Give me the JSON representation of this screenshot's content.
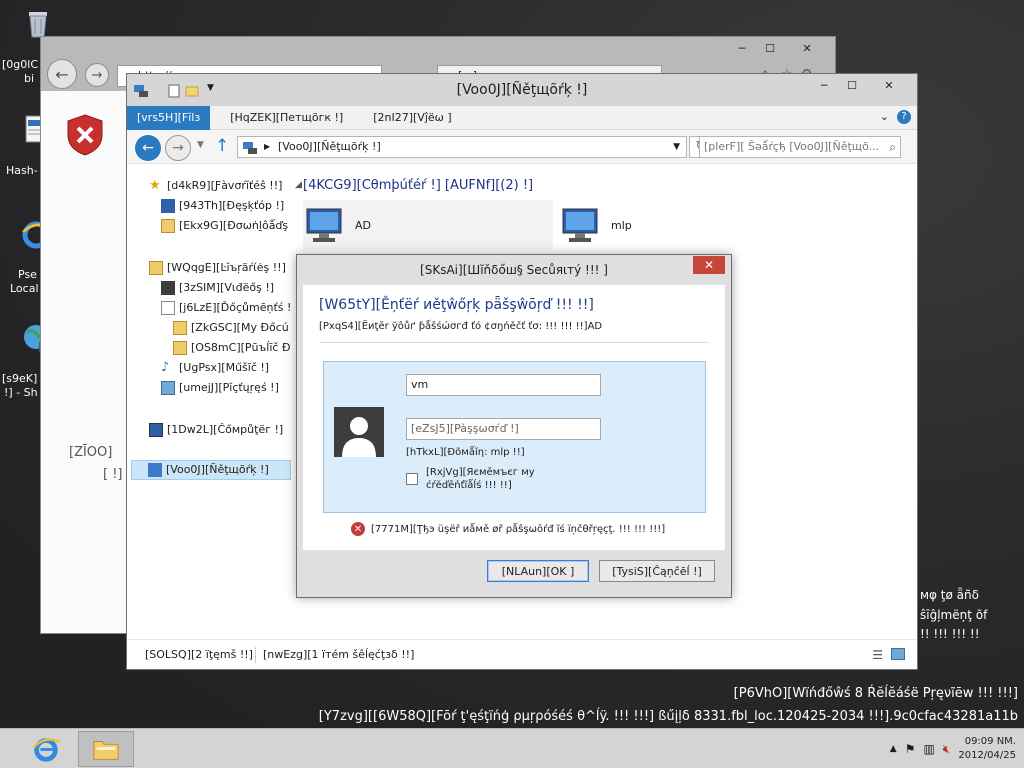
{
  "desktop": {
    "recycle_label_line1": "[0g0lC",
    "recycle_label_line2": "bi",
    "hash_label": "Hash-",
    "ie_label_line1": "Pse",
    "ie_label_line2": "Local",
    "net_label_line1": "[s9eK]",
    "net_label_line2": "!] - Sh",
    "left_text_1": "[ZĪOO]",
    "left_text_2": "[ !]",
    "right_text_1": "мφ ţø ǟñδ",
    "right_text_2": "ŝīĝļmëņţ õf",
    "right_text_3": "!! !!! !!! !!"
  },
  "ie_window": {
    "tab1": "http://... ",
    "tab2": "[...]",
    "min": "─",
    "max": "☐",
    "close": "✕"
  },
  "explorer": {
    "title": "[Voo0J][Ñěţщõŕķ !]",
    "min": "─",
    "max": "☐",
    "close": "✕",
    "tabs": [
      "[vrs5H][Fĭlз",
      "[HqZEK][Петщõгк !]",
      "[2nI27][Vĵëω ]"
    ],
    "address": "[Voo0J][Ñěţщõŕķ !]",
    "search_placeholder": "[plerF][ Ŝəǻŕçђ [Voo0J][Ñěţщõ...",
    "nav": {
      "favorites": "[d4kR9][Ƒàvσŕĭťéŝ !!]",
      "desktop": "[943Th][Ðęşķťóp !]",
      "downloads": "[Ekx9G][Ðσωṅḻôǻďş",
      "libraries": "[WQqgE][Ŀĭъŗäŕίėş !!]",
      "videos": "[3zSIM][Vιđëőş !]",
      "documents": "[j6LzE][Ďőçůmēņťś !",
      "my_documents": "[ZkGSC][My Đőcú",
      "public_docs": "[OS8mC][Pūъĺīč Ð",
      "music": "[UgPsx][Мűšĩč !]",
      "pictures": "[umejJ][Pĭçťųŗęś !]",
      "computer": "[1Dw2L][Ĉőмрůţёг !]",
      "network": "[Voo0J][Ñěţщõŕķ !]"
    },
    "section_header": "[4KCG9][Cθmþúťéŕ !] [AUFNf][(2) !]",
    "computers": [
      "AD",
      "mlp"
    ],
    "status_items": "[SOLSQ][2 ïţęmš !!]",
    "status_selected": "[nwEzg][1 ïтém šêĺęćţзδ !!]"
  },
  "dialog": {
    "title": "[SKsAi][Шĭňδőш§ Ѕеcůяιтý !!! ]",
    "close": "✕",
    "heading": "[W65tY][Ěņťëŕ иěţŵőŗķ pǟšşŵōŗď !!! !!]",
    "subheading": "[PxqS4][Ёиţěr ўôůґ ƥǻšśώσгđ ťό ¢σŋńěčť ťσ:  !!! !!! !!]AD",
    "username": "vm",
    "password_placeholder": "[eZsJ5][Pàşşωσŕď !]",
    "domain": "[hTkxL][Ðõмǻĭη: mlp !!]",
    "remember": "[RxjVg][Яємěмъєг му ćŕĕďēńťĩǻĺś !!! !!]",
    "error": "[7771M][Ţђэ üşёř иǻмě øř ρǻŝşωōŕđ ĩś їņčθřŗęçţ. !!! !!! !!!]",
    "ok": "[NLAun][OK ]",
    "cancel": "[TysiS][Ĉąņĉēĺ !]"
  },
  "watermark": {
    "line1": "[P6VhO][Wïńđőŵś 8 Ŕĕĺĕáśë Pŗęνĩēw !!! !!!]",
    "line2": "[Y7zvg][[6W58Q][Fōŕ ţ'ęśţïńģ ρµŗρóśéś θ^ĺÿ. !!! !!!] ßűįļδ 8331.fbl_loc.120425-2034 !!!].9c0cfac43281a11b"
  },
  "taskbar": {
    "time": "09:09 NM.",
    "date": "2012/04/25"
  },
  "colors": {
    "accent": "#2a7ac2",
    "close_red": "#c7463a",
    "cred_bg": "#dbedfa",
    "heading_blue": "#1e3a8a"
  }
}
